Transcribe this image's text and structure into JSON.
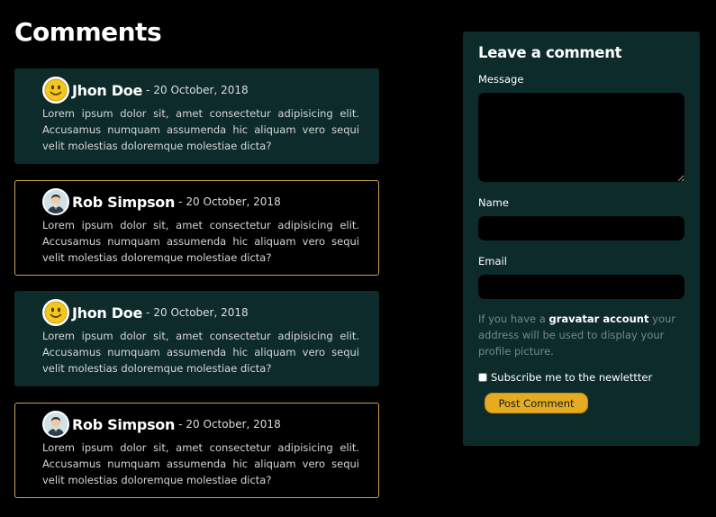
{
  "page": {
    "title": "Comments"
  },
  "comments": [
    {
      "author": "Jhon Doe",
      "separator": "-",
      "date": "20 October, 2018",
      "avatar_icon": "smiley-avatar-icon",
      "text": "Lorem ipsum dolor sit, amet consectetur adipisicing elit. Accusamus numquam assumenda hic aliquam vero sequi velit molestias doloremque molestiae dicta?"
    },
    {
      "author": "Rob Simpson",
      "separator": "-",
      "date": "20 October, 2018",
      "avatar_icon": "man-avatar-icon",
      "text": "Lorem ipsum dolor sit, amet consectetur adipisicing elit. Accusamus numquam assumenda hic aliquam vero sequi velit molestias doloremque molestiae dicta?"
    },
    {
      "author": "Jhon Doe",
      "separator": "-",
      "date": "20 October, 2018",
      "avatar_icon": "smiley-avatar-icon",
      "text": "Lorem ipsum dolor sit, amet consectetur adipisicing elit. Accusamus numquam assumenda hic aliquam vero sequi velit molestias doloremque molestiae dicta?"
    },
    {
      "author": "Rob Simpson",
      "separator": "-",
      "date": "20 October, 2018",
      "avatar_icon": "man-avatar-icon",
      "text": "Lorem ipsum dolor sit, amet consectetur adipisicing elit. Accusamus numquam assumenda hic aliquam vero sequi velit molestias doloremque molestiae dicta?"
    }
  ],
  "form": {
    "title": "Leave a comment",
    "message_label": "Message",
    "message_value": "",
    "name_label": "Name",
    "name_value": "",
    "email_label": "Email",
    "email_value": "",
    "note_before": "If you have a ",
    "note_link": "gravatar account",
    "note_after": " your address will be used to display your profile picture.",
    "subscribe_label": "Subscribe me to the newlettter",
    "subscribe_checked": false,
    "submit_label": "Post Comment"
  },
  "colors": {
    "background": "#000000",
    "card": "#0e2b2b",
    "outline": "#c9a44e",
    "button": "#e5ac22"
  }
}
